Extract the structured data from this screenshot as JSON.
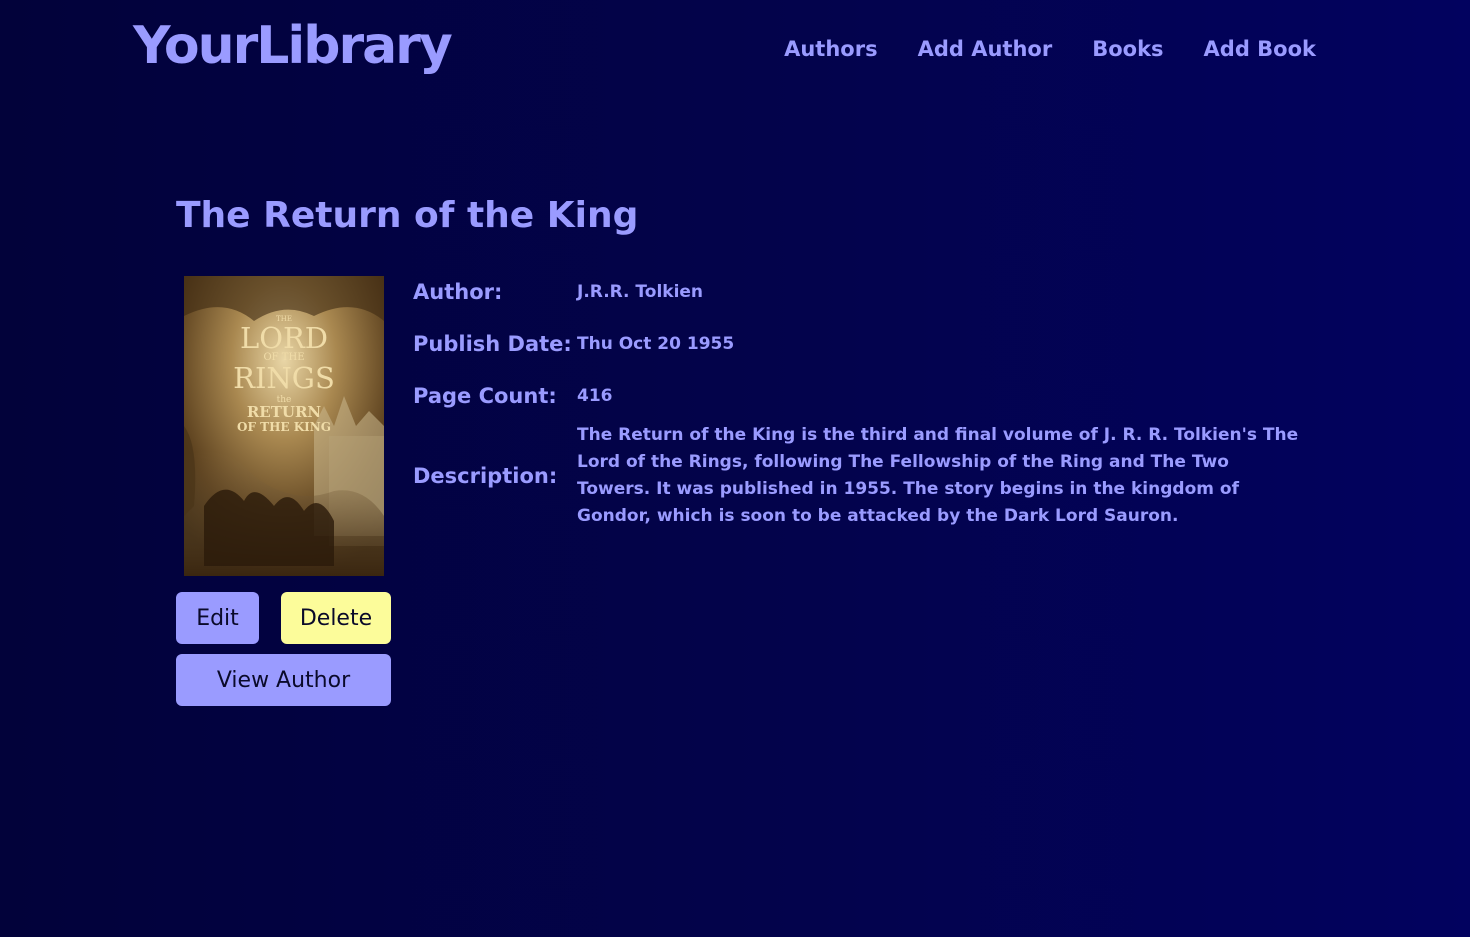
{
  "header": {
    "logo": "YourLibrary",
    "nav": [
      {
        "label": "Authors"
      },
      {
        "label": "Add Author"
      },
      {
        "label": "Books"
      },
      {
        "label": "Add Book"
      }
    ]
  },
  "book": {
    "title": "The Return of the King",
    "cover_text": {
      "line1": "THE",
      "line2": "LORD",
      "line3": "OF THE",
      "line4": "RINGS",
      "line5": "the",
      "line6": "RETURN",
      "line7": "OF THE KING"
    },
    "fields": {
      "author_label": "Author:",
      "author_value": "J.R.R. Tolkien",
      "date_label": "Publish Date:",
      "date_value": "Thu Oct 20 1955",
      "pages_label": "Page Count:",
      "pages_value": "416",
      "desc_label": "Description:",
      "desc_value": "The Return of the King is the third and final volume of J. R. R. Tolkien's The Lord of the Rings, following The Fellowship of the Ring and The Two Towers. It was published in 1955. The story begins in the kingdom of Gondor, which is soon to be attacked by the Dark Lord Sauron."
    }
  },
  "actions": {
    "edit_label": "Edit",
    "delete_label": "Delete",
    "view_author_label": "View Author"
  },
  "colors": {
    "accent": "#9a9bff",
    "delete": "#fcfc9a",
    "background": "#03034c"
  }
}
